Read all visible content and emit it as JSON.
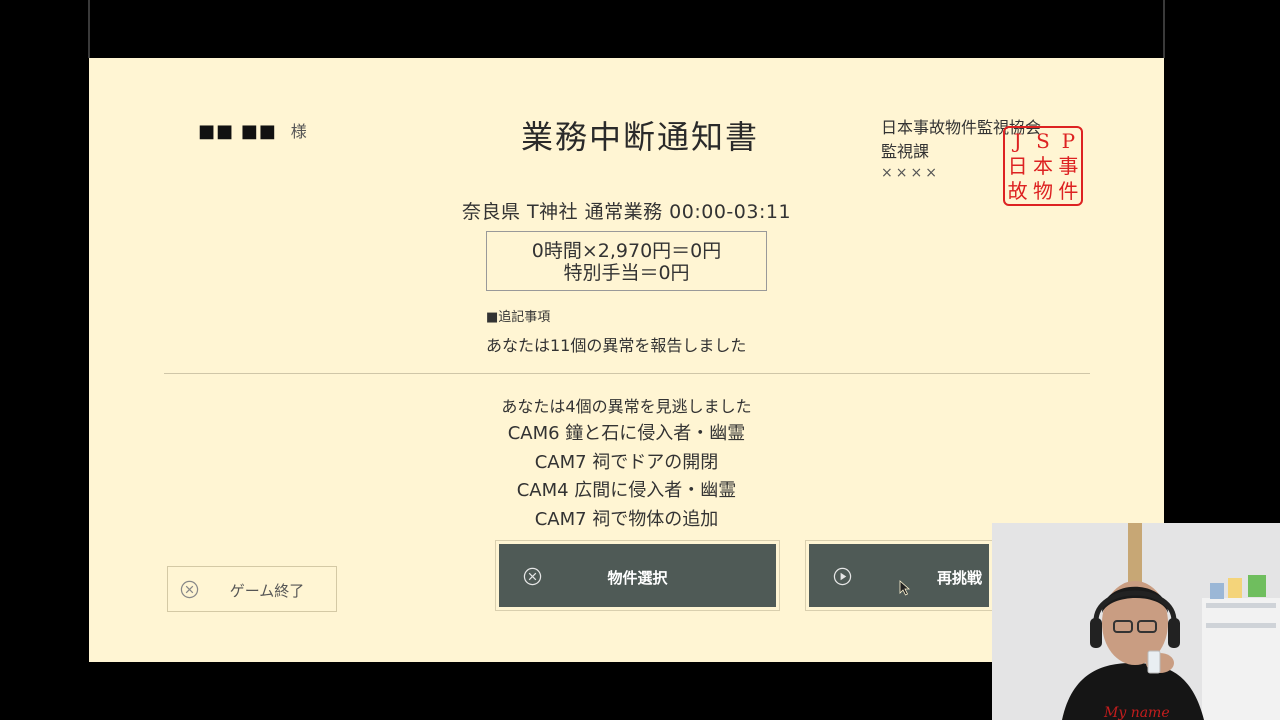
{
  "recipient": {
    "name": "■■ ■■",
    "honorific": "様"
  },
  "title": "業務中断通知書",
  "organization": {
    "name": "日本事故物件監視協会",
    "department": "監視課",
    "person": "××××"
  },
  "seal": {
    "chars": [
      "J",
      "S",
      "P",
      "日",
      "本",
      "事",
      "故",
      "物",
      "件"
    ],
    "color": "#d22222"
  },
  "shift": "奈良県 T神社 通常業務 00:00-03:11",
  "payment": {
    "line1": "0時間×2,970円＝0円",
    "line2": "特別手当＝0円"
  },
  "notes": {
    "header": "■追記事項",
    "reported": "あなたは11個の異常を報告しました"
  },
  "missed": {
    "header": "あなたは4個の異常を見逃しました",
    "items": [
      "CAM6 鐘と石に侵入者・幽霊",
      "CAM7 祠でドアの開閉",
      "CAM4 広間に侵入者・幽霊",
      "CAM7 祠で物体の追加"
    ]
  },
  "buttons": {
    "quit": {
      "label": "ゲーム終了",
      "icon": "close-circle-icon"
    },
    "select": {
      "label": "物件選択",
      "icon": "close-circle-icon"
    },
    "retry": {
      "label": "再挑戦",
      "icon": "play-circle-icon"
    }
  },
  "colors": {
    "paper": "#fff5d3",
    "button": "#4f5a56",
    "text": "#333333",
    "seal": "#d22222"
  }
}
